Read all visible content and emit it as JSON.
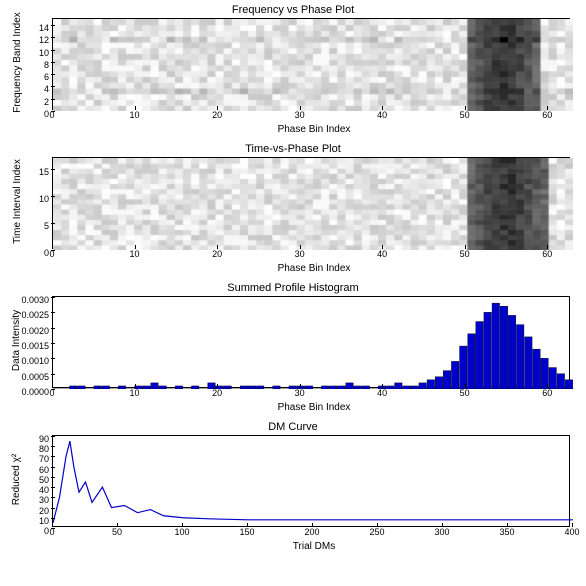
{
  "panels": {
    "freq": {
      "title": "Frequency vs Phase Plot",
      "xlabel": "Phase Bin Index",
      "ylabel": "Frequency Band Index",
      "xlim": [
        0,
        63
      ],
      "ylim": [
        0,
        15
      ],
      "xticks": [
        0,
        10,
        20,
        30,
        40,
        50,
        60
      ],
      "yticks": [
        0,
        2,
        4,
        6,
        8,
        10,
        12,
        14
      ]
    },
    "time": {
      "title": "Time-vs-Phase Plot",
      "xlabel": "Phase Bin Index",
      "ylabel": "Time Interval Index",
      "xlim": [
        0,
        63
      ],
      "ylim": [
        0,
        17
      ],
      "xticks": [
        0,
        10,
        20,
        30,
        40,
        50,
        60
      ],
      "yticks": [
        0,
        5,
        10,
        15
      ]
    },
    "profile": {
      "title": "Summed Profile Histogram",
      "xlabel": "Phase Bin Index",
      "ylabel": "Data Intensity",
      "xlim": [
        0,
        63
      ],
      "ylim": [
        0,
        0.003
      ],
      "xticks": [
        0,
        10,
        20,
        30,
        40,
        50,
        60
      ],
      "yticks": [
        0.0,
        0.0005,
        0.001,
        0.0015,
        0.002,
        0.0025,
        0.003
      ]
    },
    "dm": {
      "title": "DM Curve",
      "xlabel": "Trial DMs",
      "ylabel": "Reduced χ²",
      "xlim": [
        0,
        400
      ],
      "ylim": [
        0,
        90
      ],
      "xticks": [
        0,
        50,
        100,
        150,
        200,
        250,
        300,
        350,
        400
      ],
      "yticks": [
        0,
        10,
        20,
        30,
        40,
        50,
        60,
        70,
        80,
        90
      ]
    }
  },
  "chart_data": [
    {
      "type": "heatmap",
      "title": "Frequency vs Phase Plot",
      "xlabel": "Phase Bin Index",
      "ylabel": "Frequency Band Index",
      "nx": 64,
      "ny": 16,
      "note": "Grayscale intensity; dark vertical band (signal) spans phase bins ~51–59, broad; noise elsewhere. Rows with extra structure: 3 and 12.",
      "signal_phase_range": [
        51,
        59
      ]
    },
    {
      "type": "heatmap",
      "title": "Time-vs-Phase Plot",
      "xlabel": "Phase Bin Index",
      "ylabel": "Time Interval Index",
      "nx": 64,
      "ny": 18,
      "note": "Grayscale intensity; dark vertical band spans phase bins ~51–60; a couple of brighter blocks near phase 50 at low time rows.",
      "signal_phase_range": [
        51,
        60
      ]
    },
    {
      "type": "bar",
      "title": "Summed Profile Histogram",
      "xlabel": "Phase Bin Index",
      "ylabel": "Data Intensity",
      "ylim": [
        0,
        0.003
      ],
      "categories_start": 0,
      "categories_end": 63,
      "values": [
        0.0,
        -0.0001,
        0.0001,
        0.0001,
        0.0,
        0.0001,
        0.0001,
        0.0,
        0.0001,
        0.0,
        0.0001,
        0.0001,
        0.0002,
        0.0001,
        0.0,
        0.0001,
        0.0,
        0.0001,
        -0.0001,
        0.0002,
        0.0001,
        0.0001,
        0.0,
        0.0001,
        0.0001,
        0.0001,
        0.0,
        0.0001,
        0.0,
        0.0001,
        0.0001,
        0.0001,
        0.0,
        0.0001,
        0.0001,
        0.0001,
        0.0002,
        0.0001,
        0.0001,
        0.0,
        0.0001,
        0.0001,
        0.0002,
        0.0001,
        0.0001,
        0.0002,
        0.0003,
        0.0004,
        0.0006,
        0.0009,
        0.0014,
        0.0018,
        0.0022,
        0.0025,
        0.0028,
        0.0027,
        0.0024,
        0.0021,
        0.0017,
        0.0013,
        0.001,
        0.0007,
        0.0005,
        0.0003
      ]
    },
    {
      "type": "line",
      "title": "DM Curve",
      "xlabel": "Trial DMs",
      "ylabel": "Reduced χ²",
      "ylim": [
        0,
        90
      ],
      "x": [
        0,
        5,
        10,
        13,
        16,
        20,
        25,
        30,
        38,
        45,
        55,
        65,
        75,
        85,
        100,
        120,
        150,
        200,
        250,
        300,
        350,
        400
      ],
      "y": [
        5,
        30,
        70,
        85,
        60,
        35,
        45,
        25,
        40,
        20,
        22,
        15,
        18,
        12,
        10,
        9,
        8,
        8,
        8,
        8,
        8,
        8
      ]
    }
  ]
}
